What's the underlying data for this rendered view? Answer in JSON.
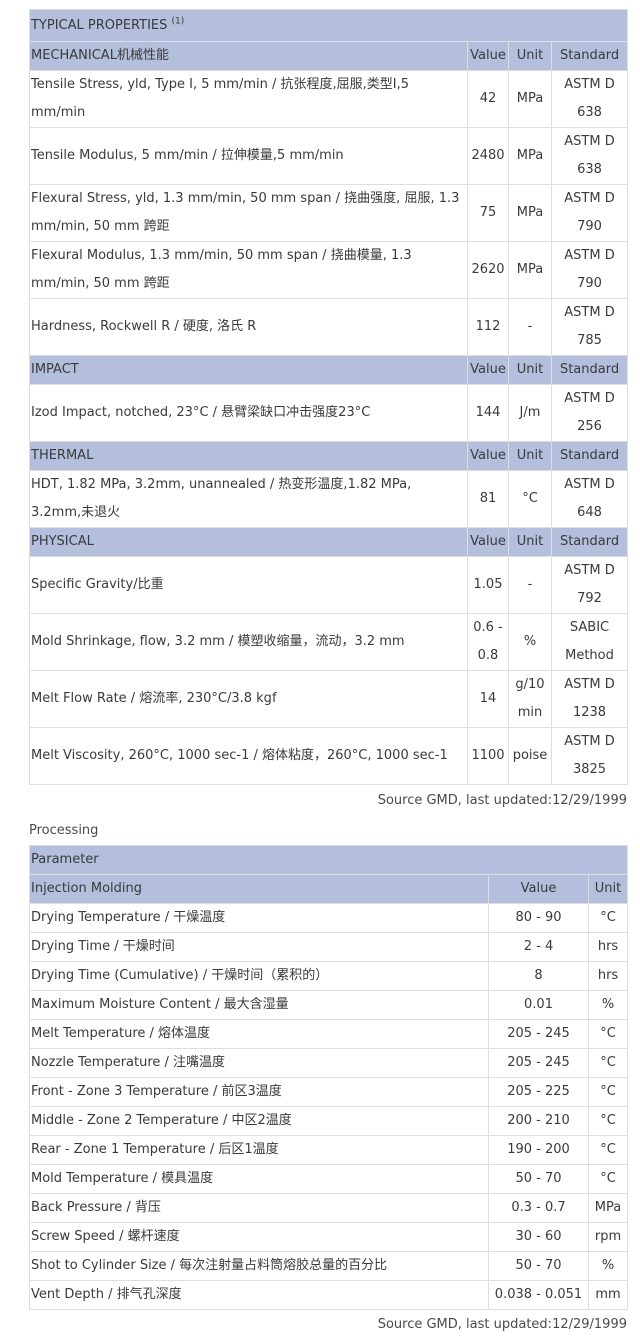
{
  "typical": {
    "title": "TYPICAL PROPERTIES",
    "title_sup": "(1)",
    "sections": [
      {
        "name": "MECHANICAL机械性能",
        "col_value": "Value",
        "col_unit": "Unit",
        "col_standard": "Standard",
        "rows": [
          {
            "property": "Tensile Stress, yld, Type I, 5 mm/min / 抗张程度,屈服,类型I,5 mm/min",
            "value": "42",
            "unit": "MPa",
            "standard": "ASTM D 638"
          },
          {
            "property": "Tensile Modulus, 5 mm/min / 拉伸模量,5 mm/min",
            "value": "2480",
            "unit": "MPa",
            "standard": "ASTM D 638"
          },
          {
            "property": "Flexural Stress, yld, 1.3 mm/min, 50 mm span / 挠曲强度, 屈服, 1.3 mm/min, 50 mm 跨距",
            "value": "75",
            "unit": "MPa",
            "standard": "ASTM D 790"
          },
          {
            "property": "Flexural Modulus, 1.3 mm/min, 50 mm span / 挠曲模量, 1.3 mm/min, 50 mm 跨距",
            "value": "2620",
            "unit": "MPa",
            "standard": "ASTM D 790"
          },
          {
            "property": "Hardness, Rockwell R / 硬度, 洛氏 R",
            "value": "112",
            "unit": "-",
            "standard": "ASTM D 785"
          }
        ]
      },
      {
        "name": "IMPACT",
        "col_value": "Value",
        "col_unit": "Unit",
        "col_standard": "Standard",
        "rows": [
          {
            "property": "Izod Impact, notched, 23°C / 悬臂梁缺口冲击强度23°C",
            "value": "144",
            "unit": "J/m",
            "standard": "ASTM D 256"
          }
        ]
      },
      {
        "name": "THERMAL",
        "col_value": "Value",
        "col_unit": "Unit",
        "col_standard": "Standard",
        "rows": [
          {
            "property": "HDT, 1.82 MPa, 3.2mm, unannealed / 热变形温度,1.82 MPa, 3.2mm,未退火",
            "value": "81",
            "unit": "°C",
            "standard": "ASTM D 648"
          }
        ]
      },
      {
        "name": "PHYSICAL",
        "col_value": "Value",
        "col_unit": "Unit",
        "col_standard": "Standard",
        "rows": [
          {
            "property": "Specific Gravity/比重",
            "value": "1.05",
            "unit": "-",
            "standard": "ASTM D 792"
          },
          {
            "property": "Mold Shrinkage, flow, 3.2 mm / 模塑收缩量，流动，3.2 mm",
            "value": "0.6 - 0.8",
            "unit": "%",
            "standard": "SABIC Method"
          },
          {
            "property": "Melt Flow Rate / 熔流率, 230°C/3.8 kgf",
            "value": "14",
            "unit": "g/10 min",
            "standard": "ASTM D 1238"
          },
          {
            "property": "Melt Viscosity, 260°C, 1000 sec-1 / 熔体粘度，260°C, 1000 sec-1",
            "value": "1100",
            "unit": "poise",
            "standard": "ASTM D 3825"
          }
        ]
      }
    ],
    "source": "Source GMD, last updated:12/29/1999"
  },
  "processing": {
    "title": "Processing",
    "parameter_header": "Parameter",
    "group": "Injection Molding",
    "col_value": "Value",
    "col_unit": "Unit",
    "rows": [
      {
        "parameter": "Drying Temperature / 干燥温度",
        "value": "80 - 90",
        "unit": "°C"
      },
      {
        "parameter": "Drying Time / 干燥时间",
        "value": "2 - 4",
        "unit": "hrs"
      },
      {
        "parameter": "Drying Time (Cumulative) / 干燥时间（累积的）",
        "value": "8",
        "unit": "hrs"
      },
      {
        "parameter": "Maximum Moisture Content / 最大含湿量",
        "value": "0.01",
        "unit": "%"
      },
      {
        "parameter": "Melt Temperature / 熔体温度",
        "value": "205 - 245",
        "unit": "°C"
      },
      {
        "parameter": "Nozzle Temperature / 注嘴温度",
        "value": "205 - 245",
        "unit": "°C"
      },
      {
        "parameter": "Front - Zone 3 Temperature / 前区3温度",
        "value": "205 - 225",
        "unit": "°C"
      },
      {
        "parameter": "Middle - Zone 2 Temperature / 中区2温度",
        "value": "200 - 210",
        "unit": "°C"
      },
      {
        "parameter": "Rear - Zone 1 Temperature / 后区1温度",
        "value": "190 - 200",
        "unit": "°C"
      },
      {
        "parameter": "Mold Temperature / 模具温度",
        "value": "50 - 70",
        "unit": "°C"
      },
      {
        "parameter": "Back Pressure / 背压",
        "value": "0.3 - 0.7",
        "unit": "MPa"
      },
      {
        "parameter": "Screw Speed / 螺杆速度",
        "value": "30 - 60",
        "unit": "rpm"
      },
      {
        "parameter": "Shot to Cylinder Size / 每次注射量占料筒熔胶总量的百分比",
        "value": "50 - 70",
        "unit": "%"
      },
      {
        "parameter": "Vent Depth / 排气孔深度",
        "value": "0.038 - 0.051",
        "unit": "mm"
      }
    ],
    "source": "Source GMD, last updated:12/29/1999"
  }
}
